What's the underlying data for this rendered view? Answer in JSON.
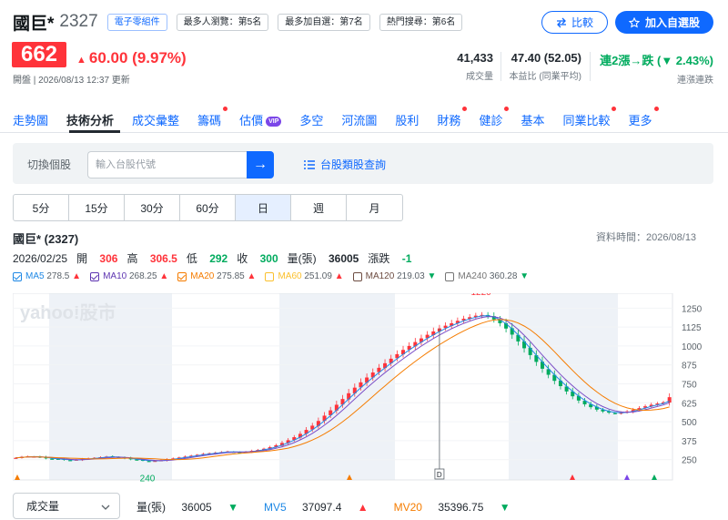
{
  "header": {
    "name": "國巨*",
    "code": "2327",
    "tags": [
      "電子零組件",
      "最多人瀏覽：第5名",
      "最多加自選：第7名",
      "熱門搜尋：第6名"
    ],
    "compare_label": "比較",
    "watchlist_label": "加入自選股",
    "price": "662",
    "change": "60.00 (9.97%)",
    "update_time": "開盤 | 2026/08/13 12:37 更新",
    "stats": [
      {
        "value": "41,433",
        "label": "成交量"
      },
      {
        "value": "47.40 (52.05)",
        "label": "本益比 (同業平均)"
      },
      {
        "value": "連2漲→跌 (▼ 2.43%)",
        "label": "連漲連跌"
      }
    ]
  },
  "nav": {
    "items": [
      "走勢圖",
      "技術分析",
      "成交彙整",
      "籌碼",
      "估價",
      "多空",
      "河流圖",
      "股利",
      "財務",
      "健診",
      "基本",
      "同業比較",
      "更多"
    ],
    "vip": "VIP"
  },
  "lookup": {
    "label": "切換個股",
    "placeholder": "輸入台股代號",
    "category_link": "台股類股查詢"
  },
  "timeframes": [
    "5分",
    "15分",
    "30分",
    "60分",
    "日",
    "週",
    "月"
  ],
  "chart_info": {
    "name": "國巨* (2327)",
    "as_of": "資料時間：2026/08/13",
    "date": "2026/02/25",
    "open_label": "開",
    "open": "306",
    "high_label": "高",
    "high": "306.5",
    "low_label": "低",
    "low": "292",
    "close_label": "收",
    "close": "300",
    "vol_label": "量(張)",
    "vol": "36005",
    "chg_label": "漲跌",
    "chg": "-1",
    "ma": [
      {
        "label": "MA5",
        "value": "278.5",
        "dir": "▲",
        "color": "#1e88e5",
        "on": true
      },
      {
        "label": "MA10",
        "value": "268.25",
        "dir": "▲",
        "color": "#5e35b1",
        "on": true
      },
      {
        "label": "MA20",
        "value": "275.85",
        "dir": "▲",
        "color": "#f57c00",
        "on": true
      },
      {
        "label": "MA60",
        "value": "251.09",
        "dir": "▲",
        "color": "#fbc02d",
        "on": false
      },
      {
        "label": "MA120",
        "value": "219.03",
        "dir": "▼",
        "color": "#6d4c41",
        "on": false
      },
      {
        "label": "MA240",
        "value": "360.28",
        "dir": "▼",
        "color": "#757575",
        "on": false
      }
    ]
  },
  "chart_data": {
    "type": "candlestick",
    "watermark": "yahoo!股市",
    "y_ticks": [
      250,
      375,
      500,
      625,
      750,
      875,
      1000,
      1125,
      1250
    ],
    "ylim": [
      170,
      1300
    ],
    "annotations": [
      {
        "text": "1220",
        "kind": "high"
      },
      {
        "text": "240",
        "kind": "low"
      }
    ],
    "marker_label": "D",
    "closes": [
      262,
      268,
      272,
      270,
      265,
      258,
      255,
      252,
      248,
      246,
      250,
      254,
      258,
      262,
      266,
      270,
      268,
      264,
      258,
      252,
      248,
      244,
      240,
      242,
      246,
      252,
      258,
      264,
      270,
      276,
      282,
      288,
      292,
      296,
      300,
      304,
      300,
      298,
      302,
      308,
      314,
      322,
      332,
      345,
      360,
      378,
      398,
      420,
      446,
      474,
      505,
      540,
      575,
      612,
      650,
      688,
      725,
      760,
      792,
      825,
      856,
      886,
      916,
      946,
      974,
      1000,
      1026,
      1050,
      1074,
      1096,
      1116,
      1134,
      1150,
      1166,
      1180,
      1190,
      1200,
      1205,
      1195,
      1175,
      1150,
      1115,
      1075,
      1030,
      985,
      940,
      895,
      850,
      810,
      770,
      735,
      700,
      668,
      640,
      615,
      596,
      580,
      568,
      560,
      556,
      560,
      568,
      578,
      590,
      602,
      612,
      620,
      628,
      662
    ]
  },
  "volume_bar": {
    "selector": "成交量",
    "vol_label": "量(張)",
    "vol": "36005",
    "vol_dir": "▼",
    "mv5_label": "MV5",
    "mv5": "37097.4",
    "mv5_dir": "▲",
    "mv20_label": "MV20",
    "mv20": "35396.75",
    "mv20_dir": "▼"
  }
}
